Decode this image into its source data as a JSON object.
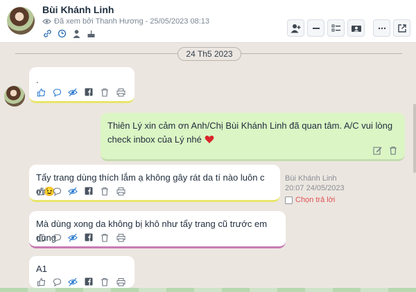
{
  "header": {
    "name": "Bùi Khánh Linh",
    "seen_text": "Đã xem bởi Thanh Hương - 25/05/2023 08:13"
  },
  "date_divider": "24 Th5 2023",
  "messages": [
    {
      "text": "."
    },
    {
      "text": "Thiên Lý xin cảm ơn Anh/Chị Bùi Khánh Linh đã quan tâm. A/C vui lòng check inbox của Lý nhé"
    },
    {
      "text": "Tẩy trang dùng thích lắm ạ không gây rát da tí nào luôn c ơi😉"
    },
    {
      "text": "Mà dùng xong da không bị khô như tẩy trang cũ trước em dùng"
    },
    {
      "text": "A1"
    }
  ],
  "meta": {
    "author": "Bùi Khánh Linh",
    "time": "20:07 24/05/2023",
    "reply_label": "Chọn trả lời"
  },
  "colors": {
    "accent_yellow": "#e8e56a",
    "accent_pink": "#c77bb3",
    "outgoing_bg": "#dbf5c4",
    "reply_red": "#e05252"
  }
}
